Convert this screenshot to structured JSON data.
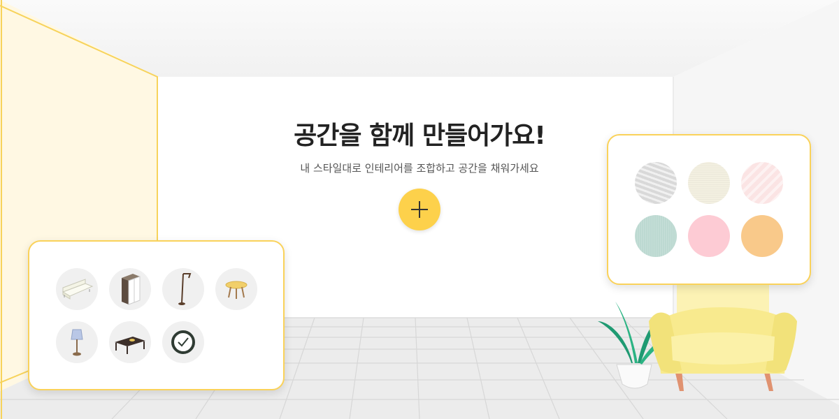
{
  "hero": {
    "title": "공간을 함께 만들어가요!",
    "subtitle": "내 스타일대로 인테리어를 조합하고 공간을 채워가세요"
  },
  "add_button": {
    "icon": "plus-icon"
  },
  "furniture_items": [
    {
      "icon": "sofa-icon"
    },
    {
      "icon": "wardrobe-icon"
    },
    {
      "icon": "floor-lamp-icon"
    },
    {
      "icon": "round-table-icon"
    },
    {
      "icon": "table-lamp-icon"
    },
    {
      "icon": "coffee-table-icon"
    },
    {
      "icon": "wall-clock-icon"
    }
  ],
  "material_swatches": [
    {
      "name": "gray-marble",
      "color": "#e2e2e2"
    },
    {
      "name": "cream-linen",
      "color": "#f3f0e1"
    },
    {
      "name": "pink-marble",
      "color": "#fbe4e4"
    },
    {
      "name": "mint-fabric",
      "color": "#bcd9d1"
    },
    {
      "name": "pink",
      "color": "#fdcbd4"
    },
    {
      "name": "apricot",
      "color": "#f9c98a"
    }
  ],
  "colors": {
    "accent": "#fdd14b",
    "panel_border": "#fad25a"
  }
}
